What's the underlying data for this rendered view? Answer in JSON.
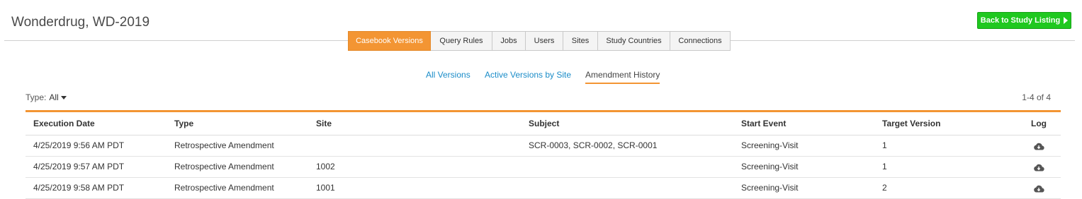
{
  "header": {
    "title": "Wonderdrug, WD-2019",
    "back_button": "Back to Study Listing"
  },
  "tabs": [
    {
      "label": "Casebook Versions",
      "active": true
    },
    {
      "label": "Query Rules"
    },
    {
      "label": "Jobs"
    },
    {
      "label": "Users"
    },
    {
      "label": "Sites"
    },
    {
      "label": "Study Countries"
    },
    {
      "label": "Connections"
    }
  ],
  "subnav": {
    "all_versions": "All Versions",
    "active_by_site": "Active Versions by Site",
    "amendment_history": "Amendment History"
  },
  "filter": {
    "label": "Type:",
    "value": "All"
  },
  "pagination": {
    "count": "1-4 of 4"
  },
  "table": {
    "columns": [
      "Execution Date",
      "Type",
      "Site",
      "Subject",
      "Start Event",
      "Target Version",
      "Log"
    ],
    "rows": [
      [
        "4/25/2019 9:56 AM PDT",
        "Retrospective Amendment",
        "",
        "SCR-0003, SCR-0002, SCR-0001",
        "Screening-Visit",
        "1"
      ],
      [
        "4/25/2019 9:57 AM PDT",
        "Retrospective Amendment",
        "1002",
        "",
        "Screening-Visit",
        "1"
      ],
      [
        "4/25/2019 9:58 AM PDT",
        "Retrospective Amendment",
        "1001",
        "",
        "Screening-Visit",
        "2"
      ]
    ],
    "log_icon": "cloud-download-icon"
  },
  "colors": {
    "accent": "#f39533",
    "link": "#1a8cc8",
    "button_green": "#1fc81f"
  }
}
